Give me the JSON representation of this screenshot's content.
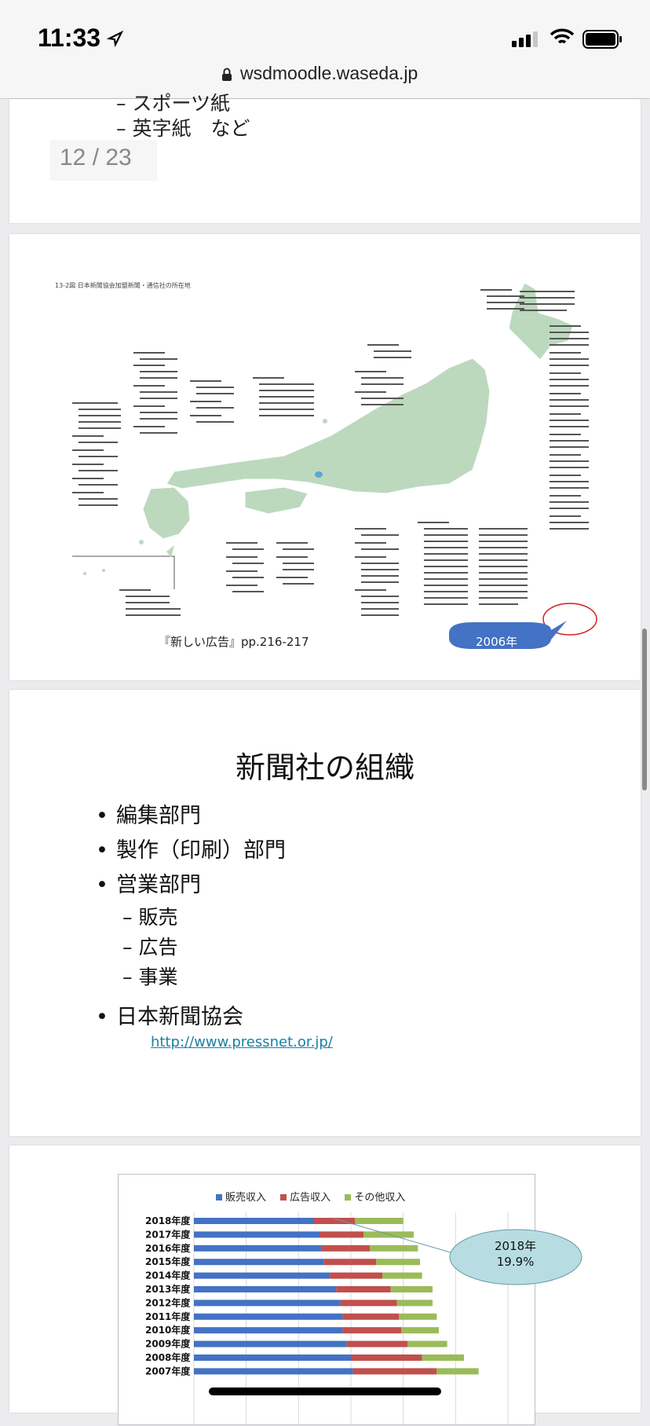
{
  "status": {
    "time": "11:33",
    "url": "wsdmoodle.waseda.jp"
  },
  "slide1": {
    "line1": "– スポーツ紙",
    "line2": "– 英字紙　など",
    "page_indicator": "12 / 23"
  },
  "slide2": {
    "map_title": "13-2図 日本新聞協会加盟新聞・通信社の所在地",
    "caption": "『新しい広告』pp.216-217",
    "year_label": "2006年"
  },
  "slide3": {
    "title": "新聞社の組織",
    "bullets": [
      "編集部門",
      "製作（印刷）部門",
      "営業部門",
      "日本新聞協会"
    ],
    "sub_items": [
      "– 販売",
      "– 広告",
      "– 事業"
    ],
    "link": "http://www.pressnet.or.jp/"
  },
  "chart_data": {
    "type": "bar",
    "stacked": true,
    "orientation": "horizontal",
    "categories": [
      "2018年度",
      "2017年度",
      "2016年度",
      "2015年度",
      "2014年度",
      "2013年度",
      "2012年度",
      "2011年度",
      "2010年度",
      "2009年度",
      "2008年度",
      "2007年度"
    ],
    "series": [
      {
        "name": "販売収入",
        "color": "#4472c4",
        "values": [
          57,
          60,
          61,
          62,
          65,
          68,
          70,
          71,
          71,
          73,
          75,
          76
        ]
      },
      {
        "name": "広告収入",
        "color": "#c0504d",
        "values": [
          20,
          21,
          23,
          25,
          25,
          26,
          27,
          27,
          28,
          29,
          34,
          40
        ]
      },
      {
        "name": "その他収入",
        "color": "#9bbb59",
        "values": [
          23,
          24,
          23,
          21,
          19,
          20,
          17,
          18,
          18,
          19,
          20,
          20
        ]
      }
    ],
    "xlim": [
      0,
      150
    ],
    "grid": true,
    "legend": "top",
    "annotation": {
      "line1": "2018年",
      "line2": "19.9%"
    }
  },
  "colors": {
    "link": "#1a7fa5",
    "map_land": "#bcd9be",
    "bubble": "#4472c4"
  }
}
